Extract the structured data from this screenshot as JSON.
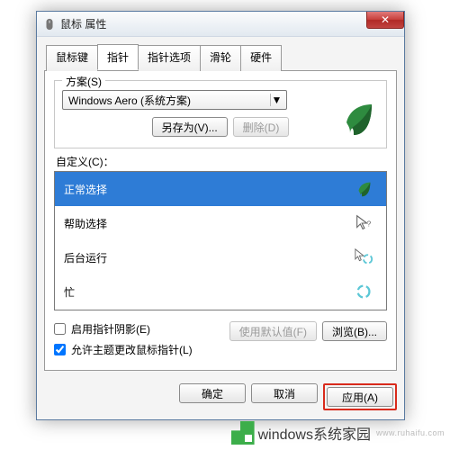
{
  "window": {
    "title": "鼠标 属性",
    "close_glyph": "✕"
  },
  "tabs": [
    {
      "label": "鼠标键"
    },
    {
      "label": "指针"
    },
    {
      "label": "指针选项"
    },
    {
      "label": "滑轮"
    },
    {
      "label": "硬件"
    }
  ],
  "scheme": {
    "group_label": "方案(S)",
    "selected": "Windows Aero (系统方案)",
    "saveas_label": "另存为(V)...",
    "delete_label": "删除(D)"
  },
  "custom": {
    "label": "自定义(C)：",
    "items": [
      {
        "name": "正常选择",
        "icon": "leaf",
        "selected": true
      },
      {
        "name": "帮助选择",
        "icon": "arrow-help",
        "selected": false
      },
      {
        "name": "后台运行",
        "icon": "arrow-spin",
        "selected": false
      },
      {
        "name": "忙",
        "icon": "spin",
        "selected": false
      }
    ]
  },
  "options": {
    "shadow_label": "启用指针阴影(E)",
    "shadow_checked": false,
    "theme_label": "允许主题更改鼠标指针(L)",
    "theme_checked": true,
    "use_default_label": "使用默认值(F)",
    "browse_label": "浏览(B)..."
  },
  "buttons": {
    "ok": "确定",
    "cancel": "取消",
    "apply": "应用(A)"
  },
  "watermark": {
    "brand": "windows系统家园",
    "sub": "www.ruhaifu.com"
  },
  "icons": {
    "mouse": "mouse-icon",
    "leaf_color": "#2e8b3f",
    "spin_color": "#5cc7d6"
  }
}
